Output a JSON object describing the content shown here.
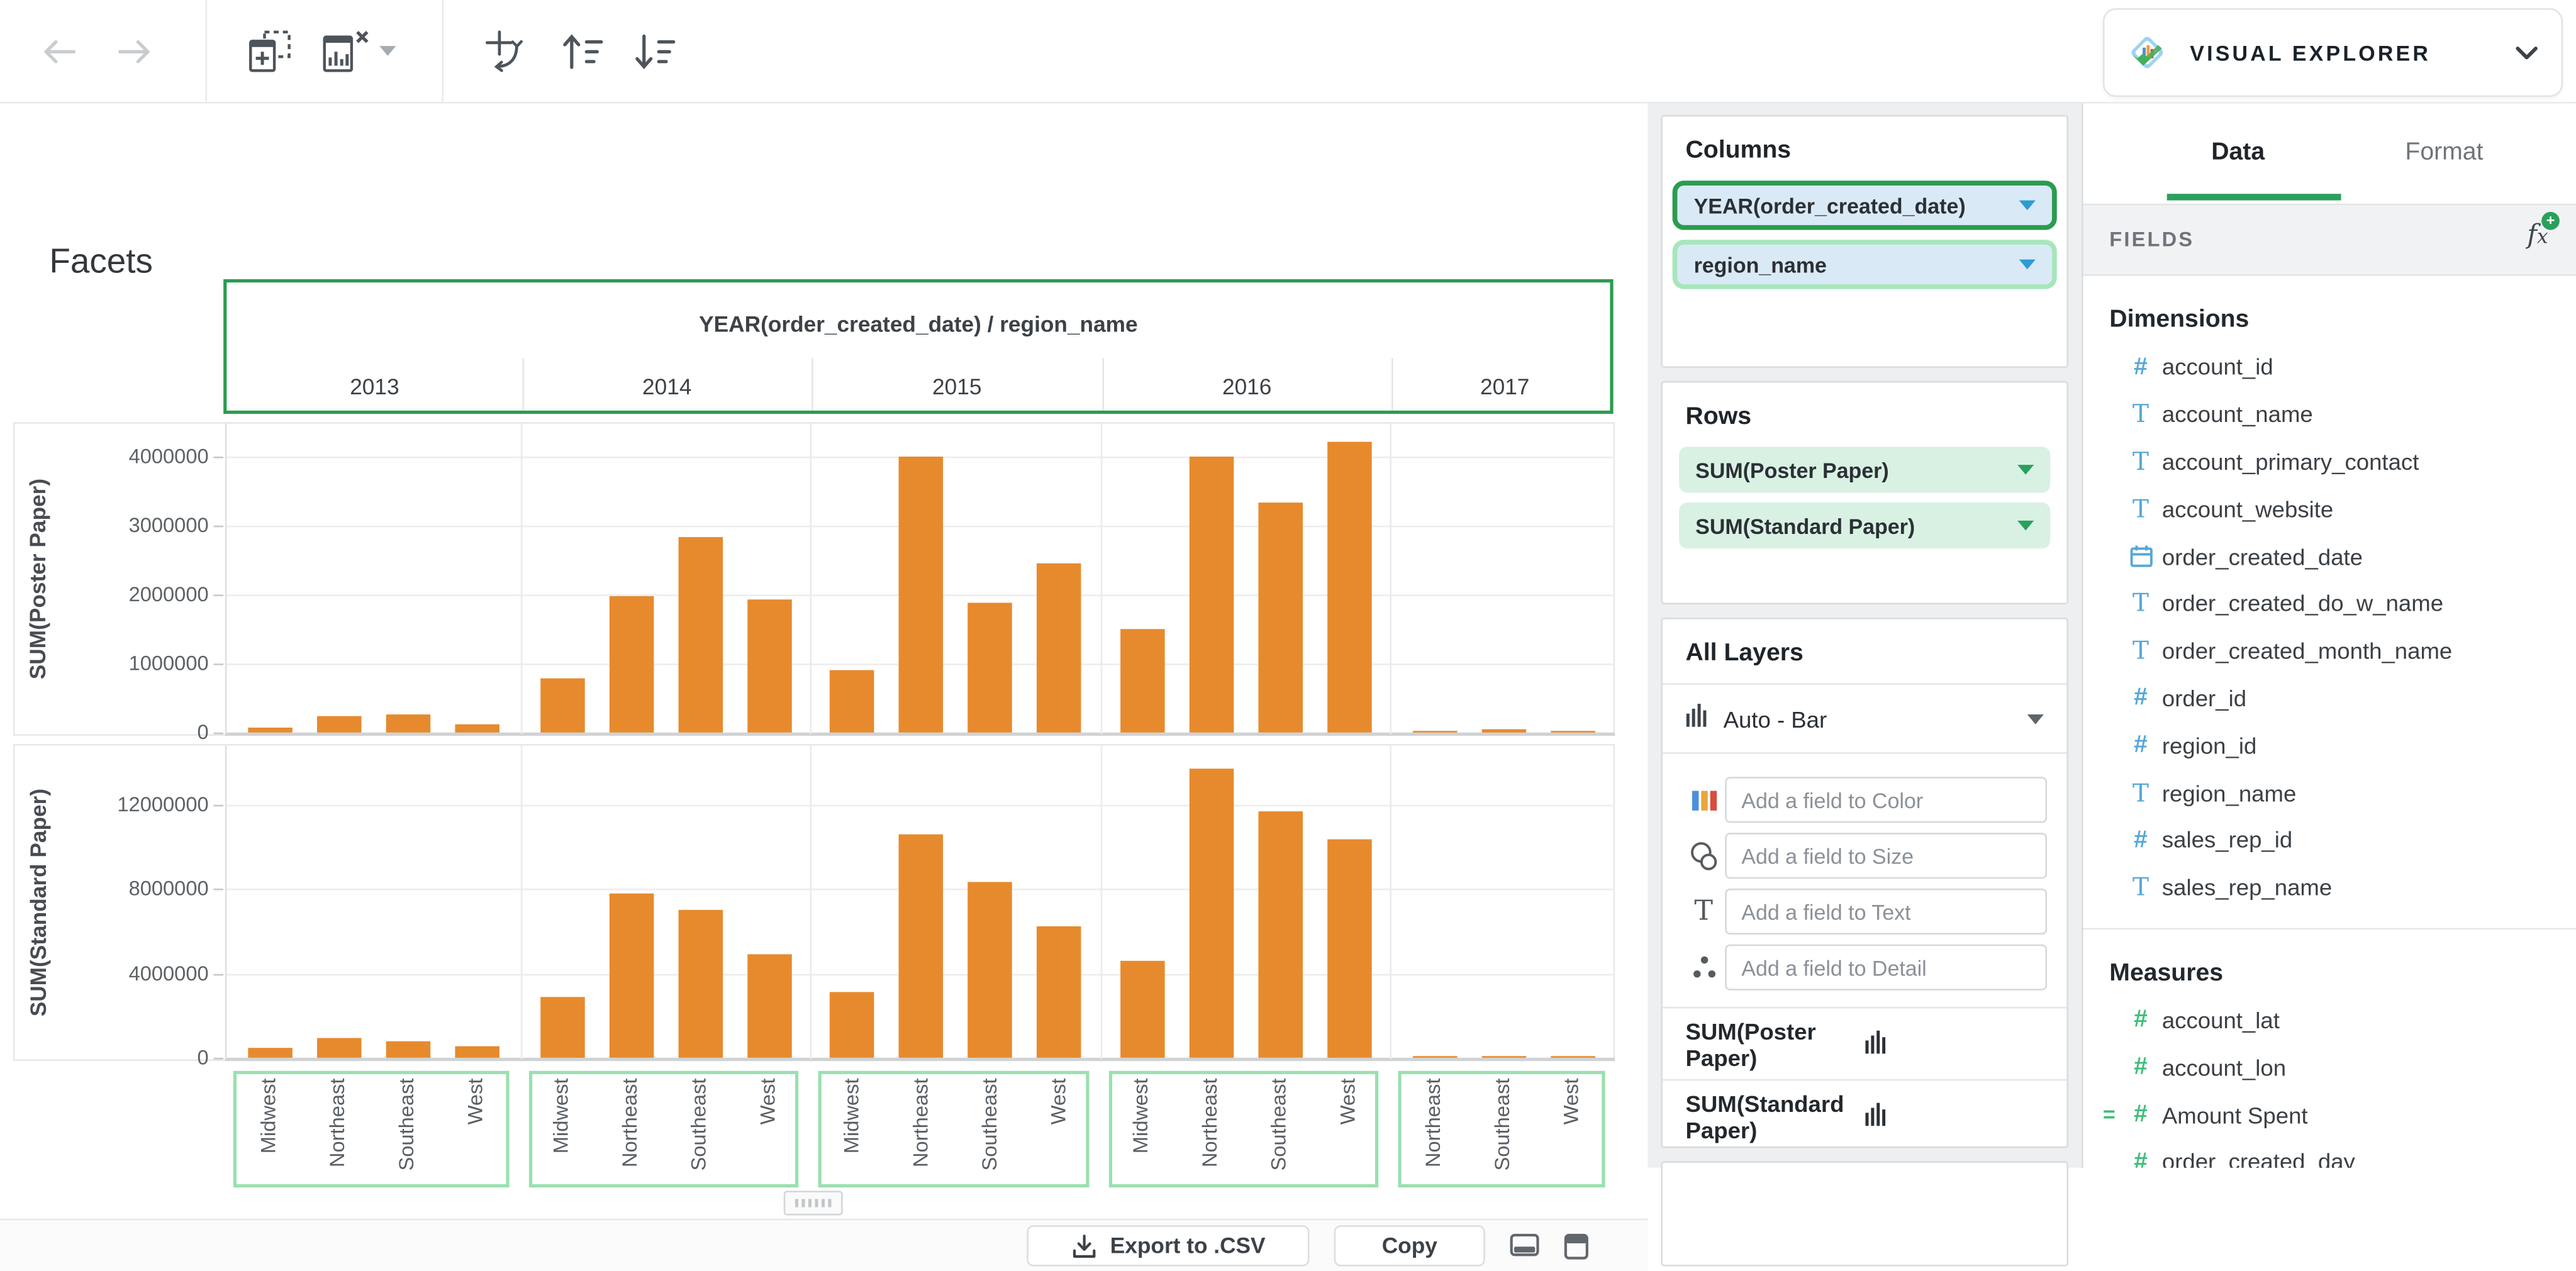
{
  "app": {
    "name": "VISUAL EXPLORER"
  },
  "toolbar": {
    "icons": [
      "back",
      "forward",
      "add-chart",
      "remove-chart",
      "remove-chart-menu",
      "swap-axes",
      "sort-ascending",
      "sort-descending"
    ]
  },
  "chart_data": {
    "type": "bar",
    "title": "Facets",
    "facet_by": "YEAR(order_created_date) / region_name",
    "bar_color": "#e78a2d",
    "grid": true,
    "legend": null,
    "facets": [
      {
        "year": "2013",
        "categories": [
          "Midwest",
          "Northeast",
          "Southeast",
          "West"
        ]
      },
      {
        "year": "2014",
        "categories": [
          "Midwest",
          "Northeast",
          "Southeast",
          "West"
        ]
      },
      {
        "year": "2015",
        "categories": [
          "Midwest",
          "Northeast",
          "Southeast",
          "West"
        ]
      },
      {
        "year": "2016",
        "categories": [
          "Midwest",
          "Northeast",
          "Southeast",
          "West"
        ]
      },
      {
        "year": "2017",
        "categories": [
          "Northeast",
          "Southeast",
          "West"
        ]
      }
    ],
    "rows": [
      {
        "measure": "SUM(Poster Paper)",
        "ylim": [
          0,
          4550000
        ],
        "yticks": [
          0,
          1000000,
          2000000,
          3000000,
          4000000
        ],
        "values": [
          [
            80000,
            240000,
            260000,
            110000
          ],
          [
            790000,
            1980000,
            2840000,
            1920000
          ],
          [
            910000,
            3990000,
            1890000,
            2450000
          ],
          [
            1510000,
            4000000,
            3340000,
            4220000
          ],
          [
            30000,
            40000,
            20000
          ]
        ]
      },
      {
        "measure": "SUM(Standard Paper)",
        "ylim": [
          0,
          14900000
        ],
        "yticks": [
          0,
          4000000,
          8000000,
          12000000
        ],
        "values": [
          [
            500000,
            900000,
            800000,
            550000
          ],
          [
            2850000,
            7800000,
            7000000,
            4900000
          ],
          [
            3100000,
            10600000,
            8300000,
            6200000
          ],
          [
            4600000,
            13700000,
            11700000,
            10400000
          ],
          [
            60000,
            90000,
            40000
          ]
        ]
      }
    ]
  },
  "shelf": {
    "columns": {
      "title": "Columns",
      "pills": [
        {
          "label": "YEAR(order_created_date)",
          "highlight": "strong"
        },
        {
          "label": "region_name",
          "highlight": "soft"
        }
      ]
    },
    "rows": {
      "title": "Rows",
      "pills": [
        {
          "label": "SUM(Poster Paper)"
        },
        {
          "label": "SUM(Standard Paper)"
        }
      ]
    },
    "layers": {
      "title": "All Layers",
      "mark_type": "Auto - Bar",
      "fields": [
        {
          "icon": "color-icon",
          "placeholder": "Add a field to Color"
        },
        {
          "icon": "size-icon",
          "placeholder": "Add a field to Size"
        },
        {
          "icon": "text-icon",
          "placeholder": "Add a field to Text"
        },
        {
          "icon": "detail-icon",
          "placeholder": "Add a field to Detail"
        }
      ],
      "layer_measures": [
        "SUM(Poster Paper)",
        "SUM(Standard Paper)"
      ]
    }
  },
  "fields_panel": {
    "tabs": [
      {
        "label": "Data",
        "active": true
      },
      {
        "label": "Format",
        "active": false
      }
    ],
    "header": "FIELDS",
    "dimensions": {
      "title": "Dimensions",
      "items": [
        {
          "name": "account_id",
          "type": "number"
        },
        {
          "name": "account_name",
          "type": "text"
        },
        {
          "name": "account_primary_contact",
          "type": "text"
        },
        {
          "name": "account_website",
          "type": "text"
        },
        {
          "name": "order_created_date",
          "type": "date"
        },
        {
          "name": "order_created_do_w_name",
          "type": "text"
        },
        {
          "name": "order_created_month_name",
          "type": "text"
        },
        {
          "name": "order_id",
          "type": "number"
        },
        {
          "name": "region_id",
          "type": "number"
        },
        {
          "name": "region_name",
          "type": "text"
        },
        {
          "name": "sales_rep_id",
          "type": "number"
        },
        {
          "name": "sales_rep_name",
          "type": "text"
        }
      ]
    },
    "measures": {
      "title": "Measures",
      "items": [
        {
          "name": "account_lat",
          "type": "number"
        },
        {
          "name": "account_lon",
          "type": "number"
        },
        {
          "name": "Amount Spent",
          "type": "number",
          "calculated": true
        },
        {
          "name": "order_created_day",
          "type": "number"
        }
      ]
    }
  },
  "footer": {
    "export_label": "Export to .CSV",
    "copy_label": "Copy"
  },
  "colors": {
    "accent_green": "#2b9c4f",
    "light_green": "#a3e4b8",
    "pill_blue": "#d9eaf6",
    "pill_green": "#d9f1e3",
    "bar_orange": "#e78a2d",
    "dimension_icon": "#55a8d9",
    "measure_icon": "#3fbf77"
  }
}
